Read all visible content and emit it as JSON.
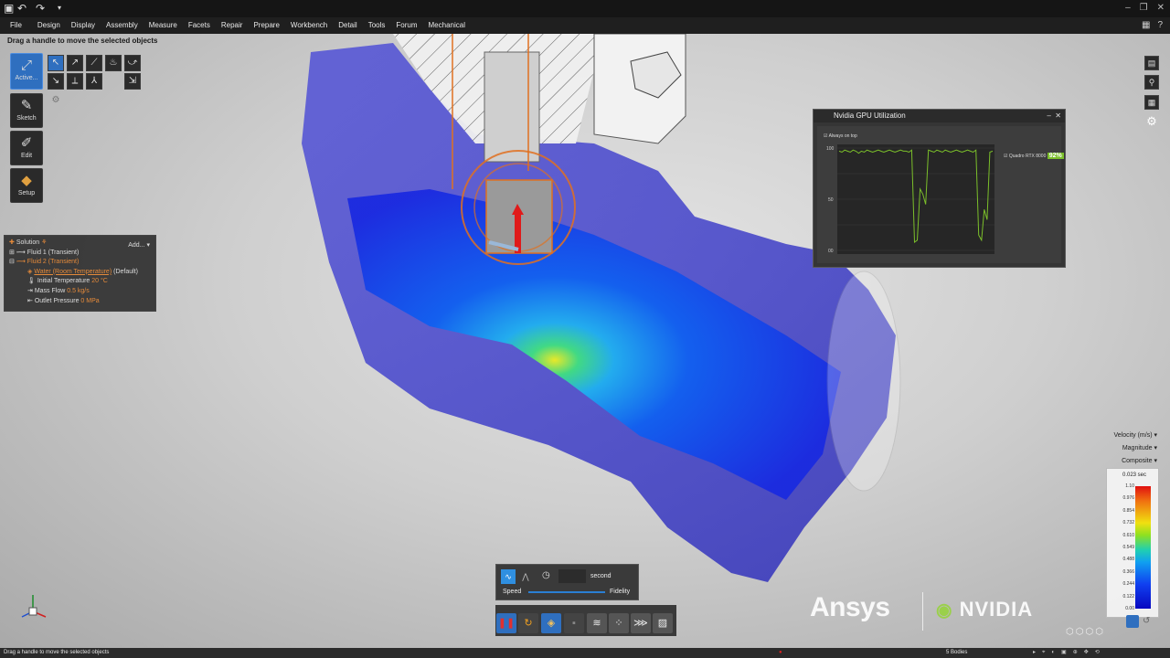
{
  "menu": {
    "items": [
      "File",
      "Design",
      "Display",
      "Assembly",
      "Measure",
      "Facets",
      "Repair",
      "Prepare",
      "Workbench",
      "Detail",
      "Tools",
      "Forum",
      "Mechanical"
    ]
  },
  "viewport": {
    "hint": "Drag a handle to move the selected objects"
  },
  "tools": {
    "active": "Active...",
    "sketch": "Sketch",
    "edit": "Edit",
    "setup": "Setup"
  },
  "tree": {
    "add": "Add...",
    "solution": "Solution",
    "fluid1": "Fluid 1 (Transient)",
    "fluid2": "Fluid 2 (Transient)",
    "material": "Water (Room Temperature)",
    "material_suffix": "(Default)",
    "init_temp_label": "Initial Temperature",
    "init_temp_value": "20 °C",
    "mass_flow_label": "Mass Flow",
    "mass_flow_value": "0.5 kg/s",
    "outlet_label": "Outlet Pressure",
    "outlet_value": "0 MPa"
  },
  "gpu": {
    "title": "Nvidia GPU Utilization",
    "always_on_top": "Always on top",
    "y_ticks": [
      "100",
      "50",
      "00"
    ],
    "gpu_name": "Quadro RTX 8000",
    "percent": "92%",
    "chart_data": {
      "type": "line",
      "series": [
        {
          "name": "Quadro RTX 8000",
          "values": [
            97,
            96,
            98,
            97,
            96,
            98,
            97,
            95,
            97,
            96,
            98,
            97,
            96,
            97,
            98,
            97,
            96,
            97,
            98,
            97,
            96,
            97,
            98,
            97,
            97,
            96,
            98,
            8,
            10,
            60,
            55,
            45,
            98,
            97,
            96,
            98,
            97,
            96,
            98,
            97,
            96,
            97,
            98,
            97,
            96,
            97,
            98,
            97,
            96,
            98,
            15,
            10,
            40,
            30,
            96,
            97
          ]
        }
      ],
      "ylim": [
        0,
        100
      ]
    }
  },
  "legend": {
    "variable": "Velocity (m/s)",
    "component": "Magnitude",
    "mode": "Composite",
    "time": "0.023 sec",
    "labels": [
      "1.10",
      "0.976",
      "0.854",
      "0.732",
      "0.610",
      "0.549",
      "0.488",
      "0.366",
      "0.244",
      "0.122",
      "0.00"
    ]
  },
  "sim": {
    "unit": "second",
    "speed": "Speed",
    "fidelity": "Fidelity"
  },
  "logos": {
    "ansys": "Ansys",
    "nvidia": "NVIDIA"
  },
  "status": {
    "message": "Drag a handle to move the selected objects",
    "bodies": "5 Bodies"
  },
  "colors": {
    "accent": "#2f6fbf",
    "orange": "#e58a3a",
    "gpu_green": "#7bbf2a"
  }
}
